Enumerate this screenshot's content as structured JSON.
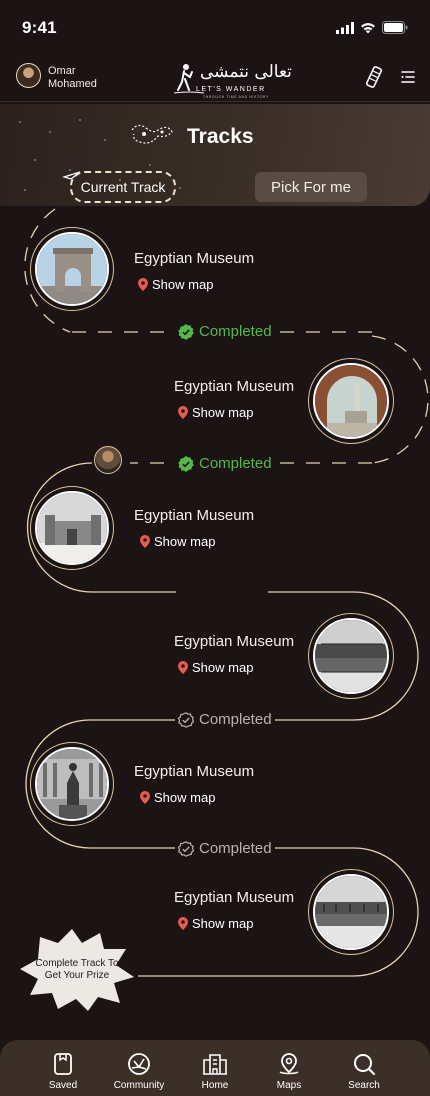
{
  "status": {
    "time": "9:41"
  },
  "header": {
    "user_name": "Omar\nMohamed",
    "logo_arabic": "تعالى نتمشى",
    "logo_english": "LET'S WANDER",
    "logo_tagline": "THROUGH TIME AND HISTORY"
  },
  "page": {
    "title": "Tracks"
  },
  "tabs": {
    "current": "Current Track",
    "pick": "Pick For me"
  },
  "stops": [
    {
      "name": "Egyptian Museum",
      "map_label": "Show map",
      "image": "arch"
    },
    {
      "name": "Egyptian Museum",
      "map_label": "Show map",
      "image": "arcade"
    },
    {
      "name": "Egyptian Museum",
      "map_label": "Show map",
      "image": "citadel"
    },
    {
      "name": "Egyptian Museum",
      "map_label": "Show map",
      "image": "reflection"
    },
    {
      "name": "Egyptian Museum",
      "map_label": "Show map",
      "image": "statue"
    },
    {
      "name": "Egyptian Museum",
      "map_label": "Show map",
      "image": "reflection"
    }
  ],
  "statuses": [
    {
      "label": "Completed",
      "state": "done",
      "color": "#55b84a"
    },
    {
      "label": "Completed",
      "state": "done",
      "color": "#55b84a"
    },
    {
      "label": "Completed",
      "state": "pending",
      "color": "#b9b2ad"
    },
    {
      "label": "Completed",
      "state": "pending",
      "color": "#b9b2ad"
    }
  ],
  "prize_badge": {
    "text": "Complete Track To Get Your Prize"
  },
  "nav": {
    "items": [
      {
        "label": "Saved",
        "icon": "bookmark-icon"
      },
      {
        "label": "Community",
        "icon": "community-icon"
      },
      {
        "label": "Home",
        "icon": "home-building-icon"
      },
      {
        "label": "Maps",
        "icon": "map-pin-icon"
      },
      {
        "label": "Search",
        "icon": "search-icon"
      }
    ]
  },
  "colors": {
    "background": "#1c1414",
    "accent_line": "#e6d3b3",
    "completed_green": "#55b84a",
    "pin_red": "#e85c4f",
    "navbar": "#3b2f28"
  }
}
